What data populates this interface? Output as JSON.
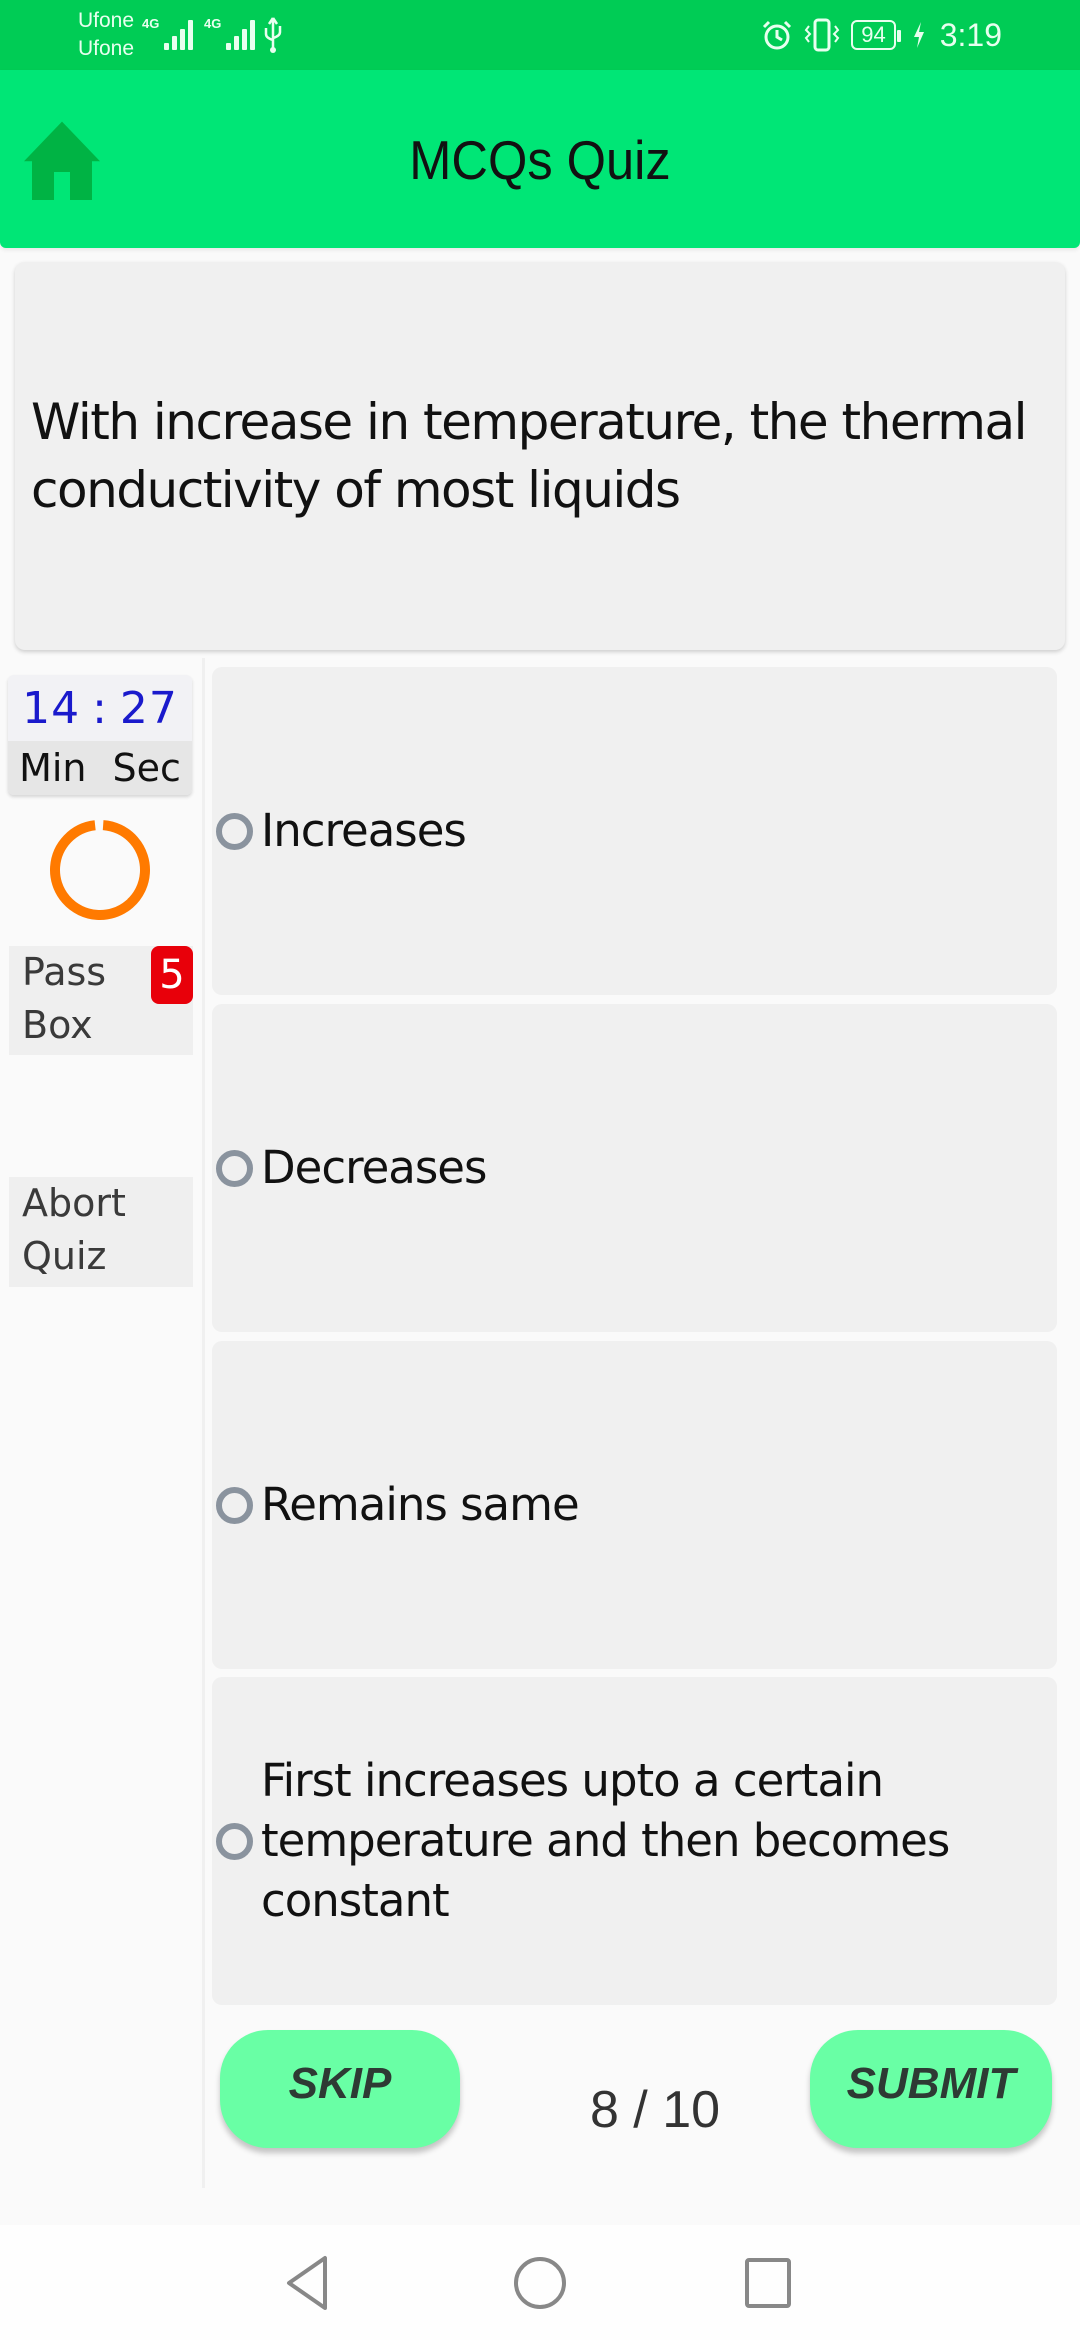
{
  "status_bar": {
    "carrier_1": "Ufone",
    "carrier_2": "Ufone",
    "network_1": "4G",
    "network_2": "4G",
    "battery_level": "94",
    "time": "3:19"
  },
  "header": {
    "title": "MCQs Quiz",
    "home_icon": "home-icon",
    "color": "#00E676"
  },
  "question": {
    "text": "With increase in temperature, the thermal conductivity of most liquids"
  },
  "timer": {
    "minutes": "14",
    "separator": ":",
    "seconds": "27",
    "min_label": "Min",
    "sec_label": "Sec",
    "progress_ring_fraction": 0.97,
    "ring_color": "#FF7A00"
  },
  "sidebar": {
    "pass_box_label_line1": "Pass",
    "pass_box_label_line2": "Box",
    "pass_count": "5",
    "abort_label_line1": "Abort",
    "abort_label_line2": "Quiz"
  },
  "options": [
    {
      "label": "Increases",
      "selected": false
    },
    {
      "label": "Decreases",
      "selected": false
    },
    {
      "label": "Remains same",
      "selected": false
    },
    {
      "label": "First increases upto a certain temperature and then becomes constant",
      "selected": false
    }
  ],
  "controls": {
    "skip_label": "SKIP",
    "submit_label": "SUBMIT",
    "counter": "8 / 10",
    "button_color": "#69FFA5"
  },
  "nav_bar": {
    "back_icon": "back-icon",
    "home_icon": "home-circle-icon",
    "recents_icon": "recents-icon"
  }
}
